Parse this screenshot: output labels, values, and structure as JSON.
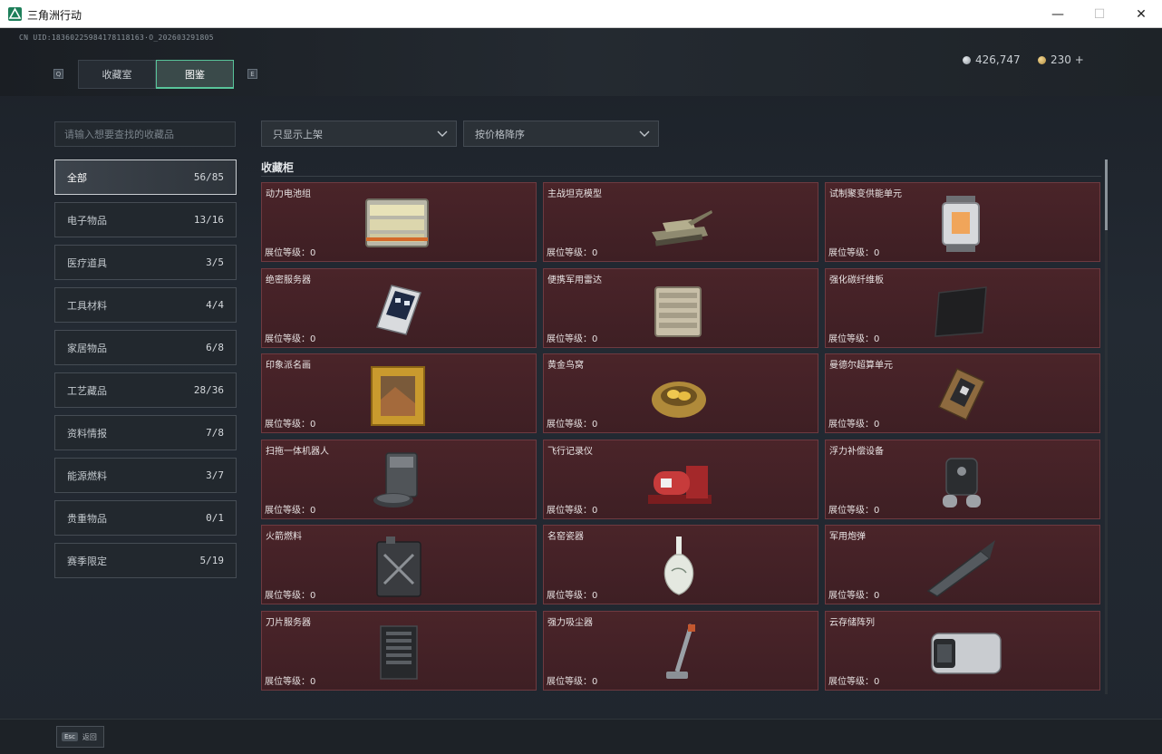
{
  "window": {
    "title": "三角洲行动"
  },
  "header": {
    "uid": "CN UID:18360225984178118163·O_202603291805",
    "hint_left": "Q",
    "hint_right": "E",
    "tabs": [
      {
        "label": "收藏室"
      },
      {
        "label": "图鉴"
      }
    ],
    "active_tab": "图鉴",
    "currency": {
      "silver": "426,747",
      "gold": "230 +"
    }
  },
  "search": {
    "placeholder": "请输入想要查找的收藏品",
    "value": ""
  },
  "filters": {
    "shelf": "只显示上架",
    "sort": "按价格降序"
  },
  "categories": [
    {
      "label": "全部",
      "count": "56/85"
    },
    {
      "label": "电子物品",
      "count": "13/16"
    },
    {
      "label": "医疗道具",
      "count": "3/5"
    },
    {
      "label": "工具材料",
      "count": "4/4"
    },
    {
      "label": "家居物品",
      "count": "6/8"
    },
    {
      "label": "工艺藏品",
      "count": "28/36"
    },
    {
      "label": "资料情报",
      "count": "7/8"
    },
    {
      "label": "能源燃料",
      "count": "3/7"
    },
    {
      "label": "贵重物品",
      "count": "0/1"
    },
    {
      "label": "赛季限定",
      "count": "5/19"
    }
  ],
  "section_title": "收藏柜",
  "items": [
    {
      "name": "动力电池组",
      "level": "展位等级：0",
      "icon": "battery-pack"
    },
    {
      "name": "主战坦克模型",
      "level": "展位等级：0",
      "icon": "tank-model"
    },
    {
      "name": "试制聚变供能单元",
      "level": "展位等级：0",
      "icon": "fusion-unit"
    },
    {
      "name": "绝密服务器",
      "level": "展位等级：0",
      "icon": "secret-server"
    },
    {
      "name": "便携军用雷达",
      "level": "展位等级：0",
      "icon": "portable-radar"
    },
    {
      "name": "强化碳纤维板",
      "level": "展位等级：0",
      "icon": "carbon-plate"
    },
    {
      "name": "印象派名画",
      "level": "展位等级：0",
      "icon": "framed-painting"
    },
    {
      "name": "黄金鸟窝",
      "level": "展位等级：0",
      "icon": "golden-nest"
    },
    {
      "name": "曼德尔超算单元",
      "level": "展位等级：0",
      "icon": "supercomputer-unit"
    },
    {
      "name": "扫拖一体机器人",
      "level": "展位等级：0",
      "icon": "mop-robot"
    },
    {
      "name": "飞行记录仪",
      "level": "展位等级：0",
      "icon": "flight-recorder"
    },
    {
      "name": "浮力补偿设备",
      "level": "展位等级：0",
      "icon": "buoyancy-device"
    },
    {
      "name": "火箭燃料",
      "level": "展位等级：0",
      "icon": "rocket-fuel"
    },
    {
      "name": "名窑瓷器",
      "level": "展位等级：0",
      "icon": "porcelain-vase"
    },
    {
      "name": "军用炮弹",
      "level": "展位等级：0",
      "icon": "artillery-shell"
    },
    {
      "name": "刀片服务器",
      "level": "展位等级：0",
      "icon": "blade-server"
    },
    {
      "name": "强力吸尘器",
      "level": "展位等级：0",
      "icon": "vacuum-cleaner"
    },
    {
      "name": "云存储阵列",
      "level": "展位等级：0",
      "icon": "storage-array"
    }
  ],
  "footer": {
    "esc_key": "Esc",
    "esc_label": "返回"
  },
  "colors": {
    "accent": "#58c49a",
    "card_bg": "#4a2429",
    "card_border": "#6e3a40"
  }
}
